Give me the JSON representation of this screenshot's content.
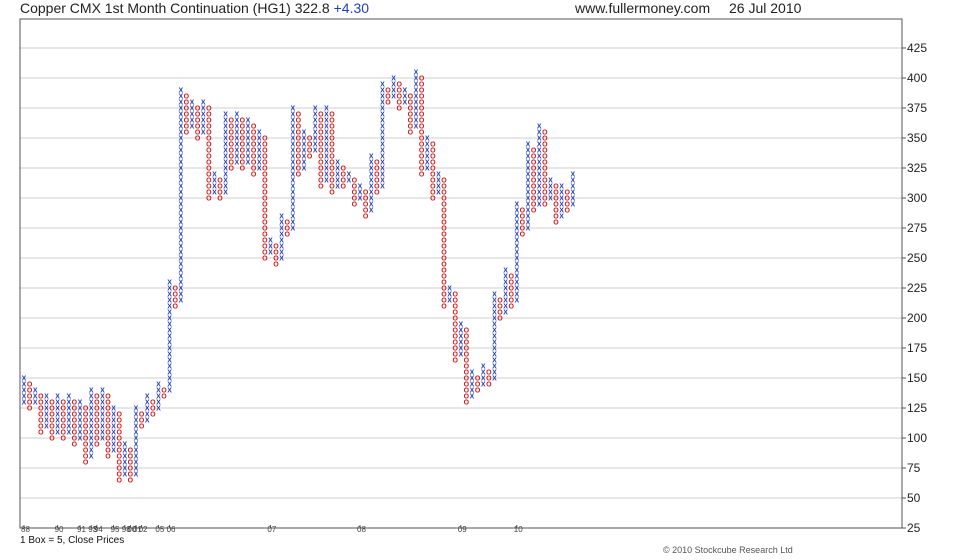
{
  "header": {
    "instrument": "Copper CMX 1st Month Continuation (HG1)",
    "last": "322.8",
    "change": "+4.30",
    "site": "www.fullermoney.com",
    "date": "26 Jul 2010"
  },
  "footer": {
    "box_note": "1 Box = 5, Close Prices",
    "copyright": "© 2010 Stockcube Research Ltd"
  },
  "colors": {
    "x_col": "#1f3fbf",
    "o_col": "#d11a1a",
    "grid": "#cfcfcf",
    "frame": "#555555",
    "change": "#1f3fbf"
  },
  "chart_data": {
    "type": "point-and-figure",
    "box_size": 5,
    "price_basis": "Close Prices",
    "y_ticks": [
      25,
      50,
      75,
      100,
      125,
      150,
      175,
      200,
      225,
      250,
      275,
      300,
      325,
      350,
      375,
      400,
      425
    ],
    "ylim": [
      25,
      425
    ],
    "grid": true,
    "x_labels": [
      {
        "col": 0,
        "text": "88"
      },
      {
        "col": 6,
        "text": "90"
      },
      {
        "col": 10,
        "text": "91"
      },
      {
        "col": 12,
        "text": "93"
      },
      {
        "col": 13,
        "text": "94"
      },
      {
        "col": 16,
        "text": "95"
      },
      {
        "col": 18,
        "text": "98"
      },
      {
        "col": 19,
        "text": "00"
      },
      {
        "col": 20,
        "text": "01"
      },
      {
        "col": 21,
        "text": "02"
      },
      {
        "col": 24,
        "text": "05"
      },
      {
        "col": 26,
        "text": "06"
      },
      {
        "col": 44,
        "text": "07"
      },
      {
        "col": 60,
        "text": "08"
      },
      {
        "col": 78,
        "text": "09"
      },
      {
        "col": 88,
        "text": "10"
      }
    ],
    "columns": [
      {
        "type": "X",
        "low": 130,
        "high": 150
      },
      {
        "type": "O",
        "low": 125,
        "high": 145
      },
      {
        "type": "X",
        "low": 130,
        "high": 140
      },
      {
        "type": "O",
        "low": 105,
        "high": 135
      },
      {
        "type": "X",
        "low": 110,
        "high": 135
      },
      {
        "type": "O",
        "low": 100,
        "high": 130
      },
      {
        "type": "X",
        "low": 105,
        "high": 135
      },
      {
        "type": "O",
        "low": 100,
        "high": 130
      },
      {
        "type": "X",
        "low": 105,
        "high": 135
      },
      {
        "type": "O",
        "low": 95,
        "high": 130
      },
      {
        "type": "X",
        "low": 100,
        "high": 130
      },
      {
        "type": "O",
        "low": 80,
        "high": 125
      },
      {
        "type": "X",
        "low": 85,
        "high": 140
      },
      {
        "type": "O",
        "low": 95,
        "high": 135
      },
      {
        "type": "X",
        "low": 100,
        "high": 140
      },
      {
        "type": "O",
        "low": 85,
        "high": 135
      },
      {
        "type": "X",
        "low": 90,
        "high": 125
      },
      {
        "type": "O",
        "low": 65,
        "high": 120
      },
      {
        "type": "X",
        "low": 70,
        "high": 95
      },
      {
        "type": "O",
        "low": 65,
        "high": 90
      },
      {
        "type": "X",
        "low": 70,
        "high": 125
      },
      {
        "type": "O",
        "low": 110,
        "high": 120
      },
      {
        "type": "X",
        "low": 115,
        "high": 135
      },
      {
        "type": "O",
        "low": 120,
        "high": 130
      },
      {
        "type": "X",
        "low": 125,
        "high": 145
      },
      {
        "type": "O",
        "low": 135,
        "high": 140
      },
      {
        "type": "X",
        "low": 140,
        "high": 230
      },
      {
        "type": "O",
        "low": 210,
        "high": 225
      },
      {
        "type": "X",
        "low": 215,
        "high": 390
      },
      {
        "type": "O",
        "low": 355,
        "high": 385
      },
      {
        "type": "X",
        "low": 360,
        "high": 380
      },
      {
        "type": "O",
        "low": 350,
        "high": 375
      },
      {
        "type": "X",
        "low": 355,
        "high": 380
      },
      {
        "type": "O",
        "low": 300,
        "high": 375
      },
      {
        "type": "X",
        "low": 305,
        "high": 320
      },
      {
        "type": "O",
        "low": 300,
        "high": 315
      },
      {
        "type": "X",
        "low": 305,
        "high": 370
      },
      {
        "type": "O",
        "low": 325,
        "high": 365
      },
      {
        "type": "X",
        "low": 330,
        "high": 370
      },
      {
        "type": "O",
        "low": 325,
        "high": 365
      },
      {
        "type": "X",
        "low": 330,
        "high": 365
      },
      {
        "type": "O",
        "low": 320,
        "high": 360
      },
      {
        "type": "X",
        "low": 325,
        "high": 355
      },
      {
        "type": "O",
        "low": 250,
        "high": 350
      },
      {
        "type": "X",
        "low": 255,
        "high": 265
      },
      {
        "type": "O",
        "low": 245,
        "high": 260
      },
      {
        "type": "X",
        "low": 250,
        "high": 285
      },
      {
        "type": "O",
        "low": 270,
        "high": 280
      },
      {
        "type": "X",
        "low": 275,
        "high": 375
      },
      {
        "type": "O",
        "low": 320,
        "high": 370
      },
      {
        "type": "X",
        "low": 325,
        "high": 355
      },
      {
        "type": "O",
        "low": 335,
        "high": 350
      },
      {
        "type": "X",
        "low": 340,
        "high": 375
      },
      {
        "type": "O",
        "low": 310,
        "high": 370
      },
      {
        "type": "X",
        "low": 315,
        "high": 375
      },
      {
        "type": "O",
        "low": 305,
        "high": 370
      },
      {
        "type": "X",
        "low": 310,
        "high": 330
      },
      {
        "type": "O",
        "low": 310,
        "high": 325
      },
      {
        "type": "X",
        "low": 315,
        "high": 320
      },
      {
        "type": "O",
        "low": 295,
        "high": 315
      },
      {
        "type": "X",
        "low": 300,
        "high": 310
      },
      {
        "type": "O",
        "low": 285,
        "high": 305
      },
      {
        "type": "X",
        "low": 290,
        "high": 335
      },
      {
        "type": "O",
        "low": 305,
        "high": 330
      },
      {
        "type": "X",
        "low": 310,
        "high": 395
      },
      {
        "type": "O",
        "low": 380,
        "high": 390
      },
      {
        "type": "X",
        "low": 385,
        "high": 400
      },
      {
        "type": "O",
        "low": 375,
        "high": 395
      },
      {
        "type": "X",
        "low": 380,
        "high": 390
      },
      {
        "type": "O",
        "low": 355,
        "high": 385
      },
      {
        "type": "X",
        "low": 360,
        "high": 405
      },
      {
        "type": "O",
        "low": 320,
        "high": 400
      },
      {
        "type": "X",
        "low": 325,
        "high": 350
      },
      {
        "type": "O",
        "low": 300,
        "high": 345
      },
      {
        "type": "X",
        "low": 305,
        "high": 320
      },
      {
        "type": "O",
        "low": 210,
        "high": 315
      },
      {
        "type": "X",
        "low": 215,
        "high": 225
      },
      {
        "type": "O",
        "low": 165,
        "high": 220
      },
      {
        "type": "X",
        "low": 170,
        "high": 195
      },
      {
        "type": "O",
        "low": 130,
        "high": 190
      },
      {
        "type": "X",
        "low": 135,
        "high": 155
      },
      {
        "type": "O",
        "low": 140,
        "high": 150
      },
      {
        "type": "X",
        "low": 145,
        "high": 160
      },
      {
        "type": "O",
        "low": 145,
        "high": 155
      },
      {
        "type": "X",
        "low": 150,
        "high": 220
      },
      {
        "type": "O",
        "low": 200,
        "high": 215
      },
      {
        "type": "X",
        "low": 205,
        "high": 240
      },
      {
        "type": "O",
        "low": 210,
        "high": 235
      },
      {
        "type": "X",
        "low": 215,
        "high": 295
      },
      {
        "type": "O",
        "low": 270,
        "high": 290
      },
      {
        "type": "X",
        "low": 275,
        "high": 345
      },
      {
        "type": "O",
        "low": 290,
        "high": 340
      },
      {
        "type": "X",
        "low": 295,
        "high": 360
      },
      {
        "type": "O",
        "low": 295,
        "high": 355
      },
      {
        "type": "X",
        "low": 300,
        "high": 315
      },
      {
        "type": "O",
        "low": 280,
        "high": 310
      },
      {
        "type": "X",
        "low": 285,
        "high": 310
      },
      {
        "type": "O",
        "low": 290,
        "high": 305
      },
      {
        "type": "X",
        "low": 295,
        "high": 320
      }
    ]
  }
}
